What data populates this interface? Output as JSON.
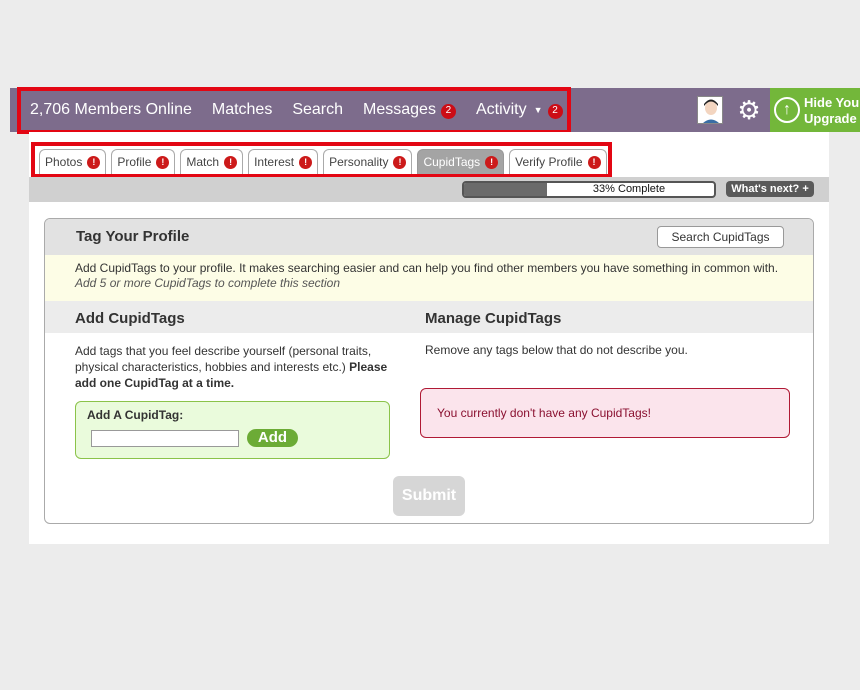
{
  "nav": {
    "members_online": "2,706 Members Online",
    "items": [
      {
        "label": "Matches"
      },
      {
        "label": "Search"
      },
      {
        "label": "Messages",
        "badge": "2"
      },
      {
        "label": "Activity",
        "badge": "2",
        "caret": "▼"
      }
    ]
  },
  "header_right": {
    "upgrade_line1": "Hide You",
    "upgrade_line2": "Upgrade",
    "upgrade_icon": "↑"
  },
  "tabs": [
    {
      "label": "Photos",
      "alert": "!"
    },
    {
      "label": "Profile",
      "alert": "!"
    },
    {
      "label": "Match",
      "alert": "!"
    },
    {
      "label": "Interest",
      "alert": "!"
    },
    {
      "label": "Personality",
      "alert": "!"
    },
    {
      "label": "CupidTags",
      "alert": "!",
      "active": true
    },
    {
      "label": "Verify Profile",
      "alert": "!"
    }
  ],
  "progress": {
    "percent": 33,
    "label": "33% Complete",
    "whats_next": "What's next? +"
  },
  "section": {
    "title": "Tag Your Profile",
    "search_button": "Search CupidTags",
    "intro": "Add CupidTags to your profile. It makes searching easier and can help you find other members you have something in common with.",
    "intro_note": "Add 5 or more CupidTags to complete this section",
    "add_title": "Add CupidTags",
    "add_desc": "Add tags that you feel describe yourself (personal traits, physical characteristics, hobbies and interests etc.)",
    "add_desc_bold": "Please add one CupidTag at a time.",
    "add_label": "Add A CupidTag:",
    "add_button": "Add",
    "add_input_value": "",
    "manage_title": "Manage CupidTags",
    "manage_desc": "Remove any tags below that do not describe you.",
    "empty_message": "You currently don't have any CupidTags!",
    "submit": "Submit"
  },
  "colors": {
    "topbar": "#7d6c8c",
    "highlight": "#e30613",
    "upgrade": "#73b73a",
    "badge": "#cc0c16"
  }
}
